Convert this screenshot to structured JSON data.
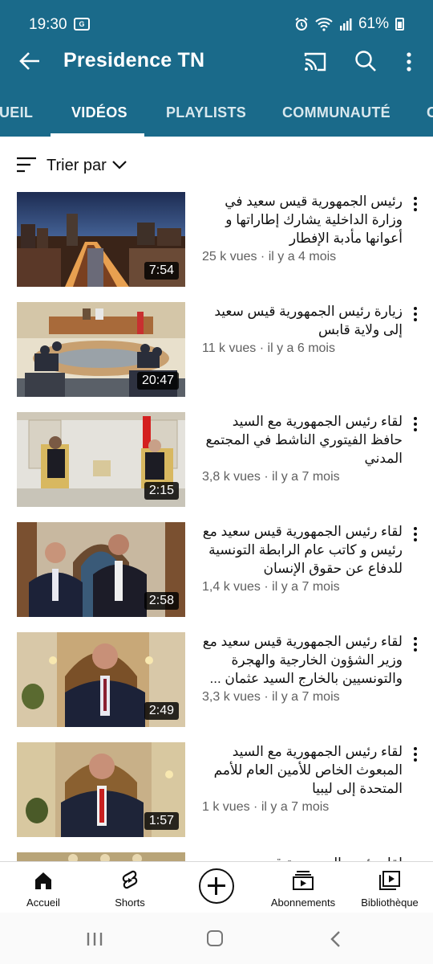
{
  "status_bar": {
    "time": "19:30",
    "battery": "61%"
  },
  "app_bar": {
    "title": "Presidence TN"
  },
  "tabs": [
    {
      "label": "UEIL"
    },
    {
      "label": "VIDÉOS",
      "active": true
    },
    {
      "label": "PLAYLISTS"
    },
    {
      "label": "COMMUNAUTÉ"
    },
    {
      "label": "C"
    }
  ],
  "sort": {
    "label": "Trier par"
  },
  "videos": [
    {
      "title": "رئيس الجمهورية قيس سعيد في وزارة الداخلية يشارك إطاراتها و أعوانها مأدبة الإفطار",
      "duration": "7:54",
      "views": "25 k vues",
      "age": "il y a 4 mois"
    },
    {
      "title": "زيارة رئيس الجمهورية قيس سعيد إلى ولاية قابس",
      "duration": "20:47",
      "views": "11 k vues",
      "age": "il y a 6 mois"
    },
    {
      "title": "لقاء رئيس الجمهورية مع السيد حافظ الفيتوري الناشط في المجتمع المدني",
      "duration": "2:15",
      "views": "3,8 k vues",
      "age": "il y a 7 mois"
    },
    {
      "title": "لقاء رئيس الجمهورية قيس سعيد مع رئيس و كاتب عام الرابطة التونسية للدفاع عن حقوق الإنسان",
      "duration": "2:58",
      "views": "1,4 k vues",
      "age": "il y a 7 mois"
    },
    {
      "title": "لقاء رئيس الجمهورية قيس سعيد مع وزير الشؤون الخارجية والهجرة والتونسيين بالخارج السيد عثمان ...",
      "duration": "2:49",
      "views": "3,3 k vues",
      "age": "il y a 7 mois"
    },
    {
      "title": "لقاء رئيس الجمهورية مع السيد المبعوث الخاص للأمين العام للأمم المتحدة إلى ليبيا",
      "duration": "1:57",
      "views": "1 k vues",
      "age": "il y a 7 mois"
    }
  ],
  "partial_video": {
    "title": "لقاء رئيس الجمهورية قيس سعيد"
  },
  "bottom_nav": [
    {
      "label": "Accueil",
      "icon": "home-icon"
    },
    {
      "label": "Shorts",
      "icon": "shorts-icon"
    },
    {
      "label": "",
      "icon": "create-icon"
    },
    {
      "label": "Abonnements",
      "icon": "subscriptions-icon"
    },
    {
      "label": "Bibliothèque",
      "icon": "library-icon"
    }
  ],
  "colors": {
    "header": "#1a6a8a",
    "meta_text": "#606060"
  }
}
